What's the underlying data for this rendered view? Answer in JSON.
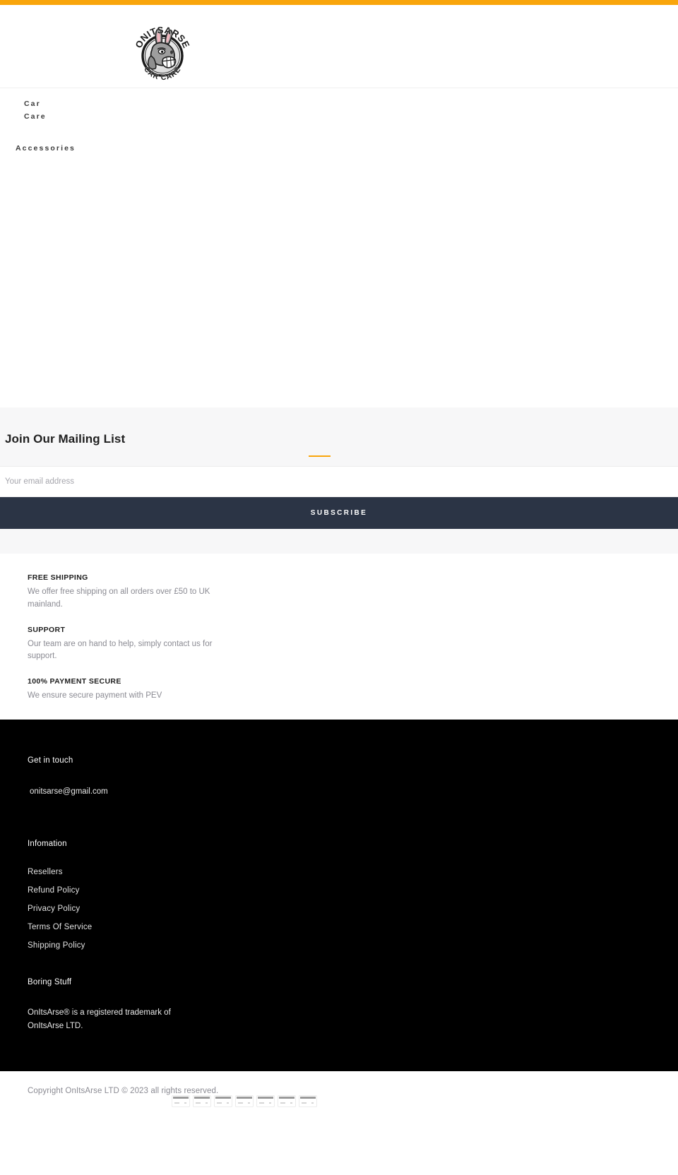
{
  "topbar": {
    "color": "#f9a50b"
  },
  "header": {
    "logo": {
      "icon": "onitsarse-donkey-logo",
      "top_text": "ONITSARSE",
      "bottom_text": "CAR CARE",
      "alt": "OnItsArse Car Care"
    }
  },
  "nav": {
    "items": [
      {
        "label": "Car Care",
        "name": "nav-item-car-care"
      },
      {
        "label": "Accessories",
        "name": "nav-item-accessories"
      }
    ]
  },
  "mailing": {
    "heading": "Join Our Mailing List",
    "divider_color": "#f9a50b",
    "email_placeholder": "Your email address",
    "email_value": "",
    "subscribe_label": "SUBSCRIBE",
    "subscribe_color": "#2b3445"
  },
  "features": [
    {
      "title": "FREE SHIPPING",
      "text": "We offer free shipping on all orders over £50 to UK mainland."
    },
    {
      "title": "SUPPORT",
      "text": "Our team are on hand to help, simply contact us for support."
    },
    {
      "title": "100% PAYMENT SECURE",
      "text": "We ensure secure payment with PEV"
    }
  ],
  "footer": {
    "get_in_touch_heading": "Get in touch",
    "email": "onitsarse@gmail.com",
    "information_heading": "Infomation",
    "information_links": [
      "Resellers",
      "Refund Policy",
      "Privacy Policy",
      "Terms Of Service",
      "Shipping Policy"
    ],
    "boring_heading": "Boring Stuff",
    "boring_text": "OnItsArse® is a registered trademark of OnItsArse LTD."
  },
  "copyright": {
    "text": "Copyright OnItsArse LTD © 2023 all rights reserved.",
    "payment_icons": [
      "payment-card-icon-1",
      "payment-card-icon-2",
      "payment-card-icon-3",
      "payment-card-icon-4",
      "payment-card-icon-5",
      "payment-card-icon-6",
      "payment-card-icon-7"
    ]
  }
}
